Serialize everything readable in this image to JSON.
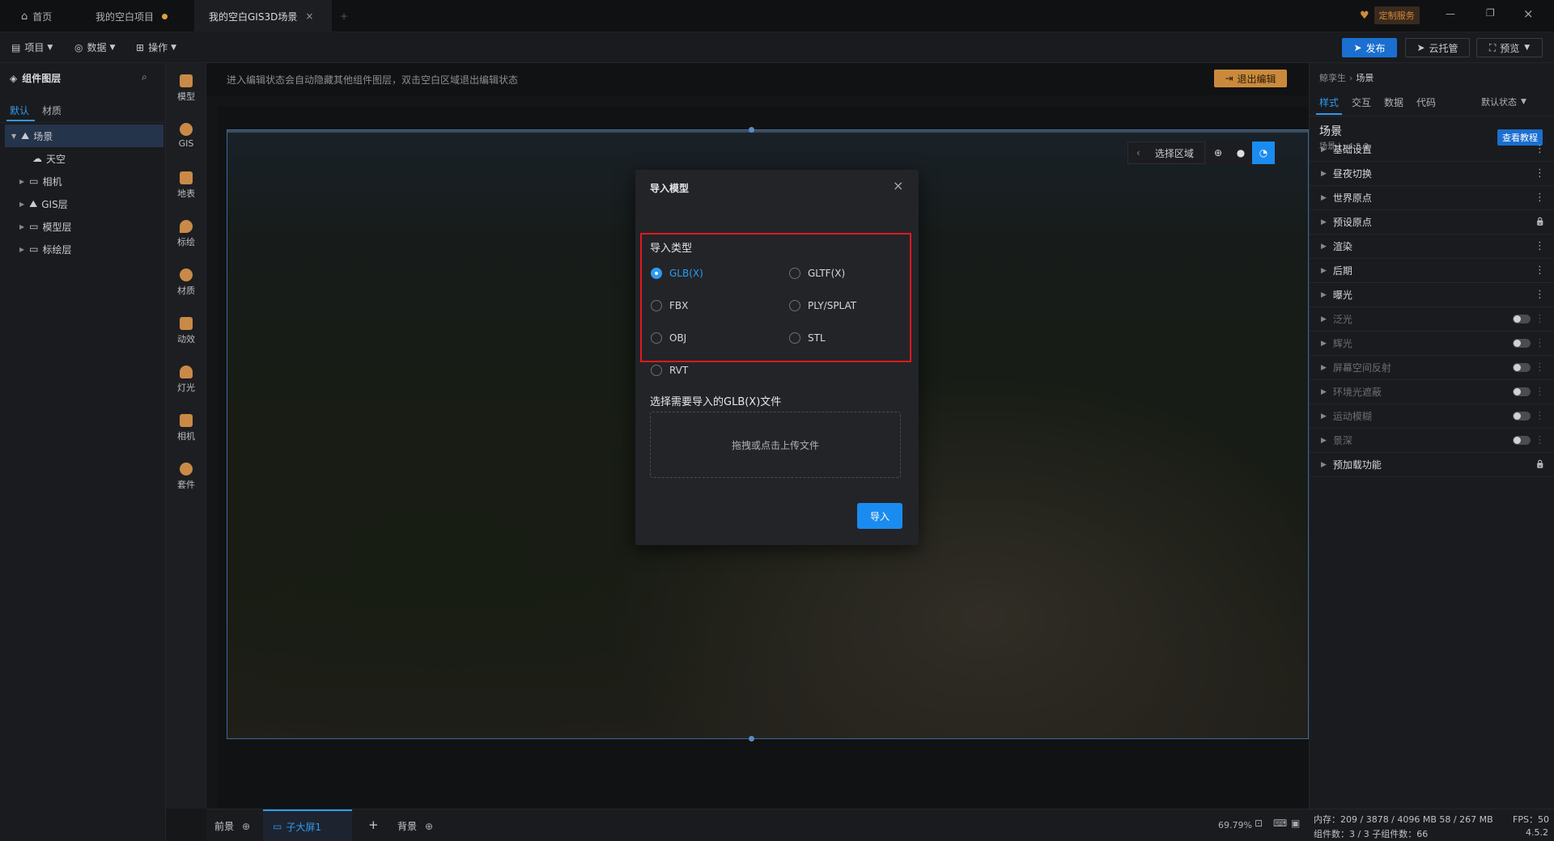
{
  "titlebar": {
    "tabs": [
      {
        "label": "首页"
      },
      {
        "label": "我的空白项目"
      },
      {
        "label": "我的空白GIS3D场景"
      }
    ],
    "service_label": "定制服务"
  },
  "toolbar": {
    "menus": [
      {
        "label": "项目"
      },
      {
        "label": "数据"
      },
      {
        "label": "操作"
      }
    ],
    "publish_label": "发布",
    "cloud_label": "云托管",
    "preview_label": "预览"
  },
  "left_panel": {
    "title": "组件图层",
    "tabs": [
      "默认",
      "材质"
    ],
    "tree": [
      {
        "label": "场景"
      },
      {
        "label": "天空"
      },
      {
        "label": "相机"
      },
      {
        "label": "GIS层"
      },
      {
        "label": "模型层"
      },
      {
        "label": "标绘层"
      }
    ]
  },
  "icon_column": {
    "items": [
      {
        "label": "模型",
        "icon": "model-icon"
      },
      {
        "label": "GIS",
        "icon": "globe-icon"
      },
      {
        "label": "地表",
        "icon": "terrain-icon"
      },
      {
        "label": "标绘",
        "icon": "marker-icon"
      },
      {
        "label": "材质",
        "icon": "material-icon"
      },
      {
        "label": "动效",
        "icon": "effect-icon"
      },
      {
        "label": "灯光",
        "icon": "light-icon"
      },
      {
        "label": "相机",
        "icon": "camera-icon"
      },
      {
        "label": "套件",
        "icon": "kit-icon"
      }
    ]
  },
  "canvas": {
    "hint": "进入编辑状态会自动隐藏其他组件图层，双击空白区域退出编辑状态",
    "exit_edit_label": "退出编辑",
    "select_region_label": "选择区域"
  },
  "right_panel": {
    "breadcrumb_parent": "鲸孪生",
    "breadcrumb_current": "场景",
    "tabs": [
      "样式",
      "交互",
      "数据",
      "代码"
    ],
    "state_select": "默认状态",
    "component_title": "场景",
    "component_subtitle": "场景 | v4.5.2",
    "tutorial_label": "查看教程",
    "sections": [
      {
        "label": "基础设置",
        "control": "kebab"
      },
      {
        "label": "昼夜切换",
        "control": "kebab"
      },
      {
        "label": "世界原点",
        "control": "kebab"
      },
      {
        "label": "预设原点",
        "control": "lock"
      },
      {
        "label": "渲染",
        "control": "kebab"
      },
      {
        "label": "后期",
        "control": "kebab"
      },
      {
        "label": "曝光",
        "control": "kebab"
      },
      {
        "label": "泛光",
        "control": "toggle"
      },
      {
        "label": "辉光",
        "control": "toggle"
      },
      {
        "label": "屏幕空间反射",
        "control": "toggle"
      },
      {
        "label": "环境光遮蔽",
        "control": "toggle"
      },
      {
        "label": "运动模糊",
        "control": "toggle"
      },
      {
        "label": "景深",
        "control": "toggle"
      },
      {
        "label": "预加载功能",
        "control": "lock"
      }
    ]
  },
  "bottom_bar": {
    "tabs": [
      "前景",
      "子大屏1",
      "背景"
    ],
    "zoom": "69.79%"
  },
  "status": {
    "memory": "内存：209 / 3878 / 4096 MB  58 / 267 MB",
    "fps": "FPS：50",
    "components": "组件数：3 / 3  子组件数：66",
    "version": "4.5.2"
  },
  "modal": {
    "title": "导入模型",
    "type_label": "导入类型",
    "options": [
      {
        "label": "GLB(X)",
        "checked": true
      },
      {
        "label": "GLTF(X)",
        "checked": false
      },
      {
        "label": "FBX",
        "checked": false
      },
      {
        "label": "PLY/SPLAT",
        "checked": false
      },
      {
        "label": "OBJ",
        "checked": false
      },
      {
        "label": "STL",
        "checked": false
      },
      {
        "label": "RVT",
        "checked": false
      }
    ],
    "file_label": "选择需要导入的GLB(X)文件",
    "upload_hint": "拖拽或点击上传文件",
    "import_button": "导入"
  },
  "colors": {
    "accent": "#1a8cf0",
    "highlight_box": "#e0191f",
    "exit_button": "#c98a3c"
  }
}
